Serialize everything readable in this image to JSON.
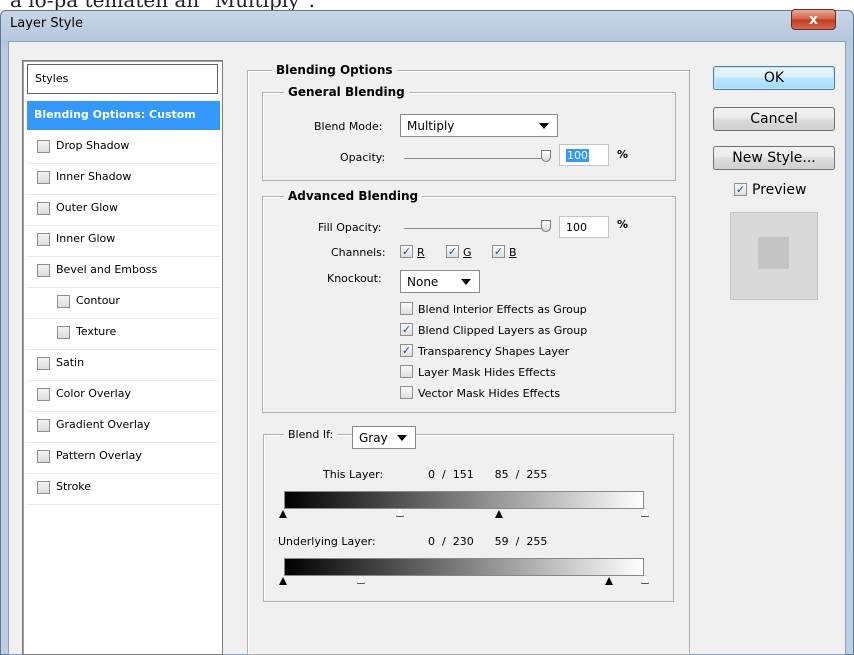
{
  "top_text": "a lo-pa tematen an \"Multiply\".",
  "window": {
    "title": "Layer Style",
    "close_label": "x"
  },
  "styles": {
    "header": "Styles",
    "selected": "Blending Options: Custom",
    "items": [
      {
        "label": "Drop Shadow",
        "indent": false
      },
      {
        "label": "Inner Shadow",
        "indent": false
      },
      {
        "label": "Outer Glow",
        "indent": false
      },
      {
        "label": "Inner Glow",
        "indent": false
      },
      {
        "label": "Bevel and Emboss",
        "indent": false
      },
      {
        "label": "Contour",
        "indent": true
      },
      {
        "label": "Texture",
        "indent": true
      },
      {
        "label": "Satin",
        "indent": false
      },
      {
        "label": "Color Overlay",
        "indent": false
      },
      {
        "label": "Gradient Overlay",
        "indent": false
      },
      {
        "label": "Pattern Overlay",
        "indent": false
      },
      {
        "label": "Stroke",
        "indent": false
      }
    ]
  },
  "blending": {
    "title": "Blending Options",
    "general": {
      "title": "General Blending",
      "blend_mode_label": "Blend Mode:",
      "blend_mode_value": "Multiply",
      "opacity_label": "Opacity:",
      "opacity_value": "100",
      "opacity_unit": "%",
      "opacity_level": 100
    },
    "advanced": {
      "title": "Advanced Blending",
      "fill_label": "Fill Opacity:",
      "fill_value": "100",
      "fill_unit": "%",
      "fill_level": 100,
      "channels_label": "Channels:",
      "channel_r": "R",
      "channel_g": "G",
      "channel_b": "B",
      "knockout_label": "Knockout:",
      "knockout_value": "None",
      "options": [
        {
          "label": "Blend Interior Effects as Group",
          "checked": false
        },
        {
          "label": "Blend Clipped Layers as Group",
          "checked": true
        },
        {
          "label": "Transparency Shapes Layer",
          "checked": true
        },
        {
          "label": "Layer Mask Hides Effects",
          "checked": false
        },
        {
          "label": "Vector Mask Hides Effects",
          "checked": false
        }
      ]
    },
    "blend_if": {
      "label": "Blend If:",
      "value": "Gray",
      "this_layer_label": "This Layer:",
      "this_layer_values": "0  /  151      85  /  255",
      "underlying_label": "Underlying Layer:",
      "underlying_values": "0  /  230      59  /  255"
    }
  },
  "buttons": {
    "ok": "OK",
    "cancel": "Cancel",
    "new_style": "New Style...",
    "preview": "Preview",
    "preview_checked": true
  }
}
